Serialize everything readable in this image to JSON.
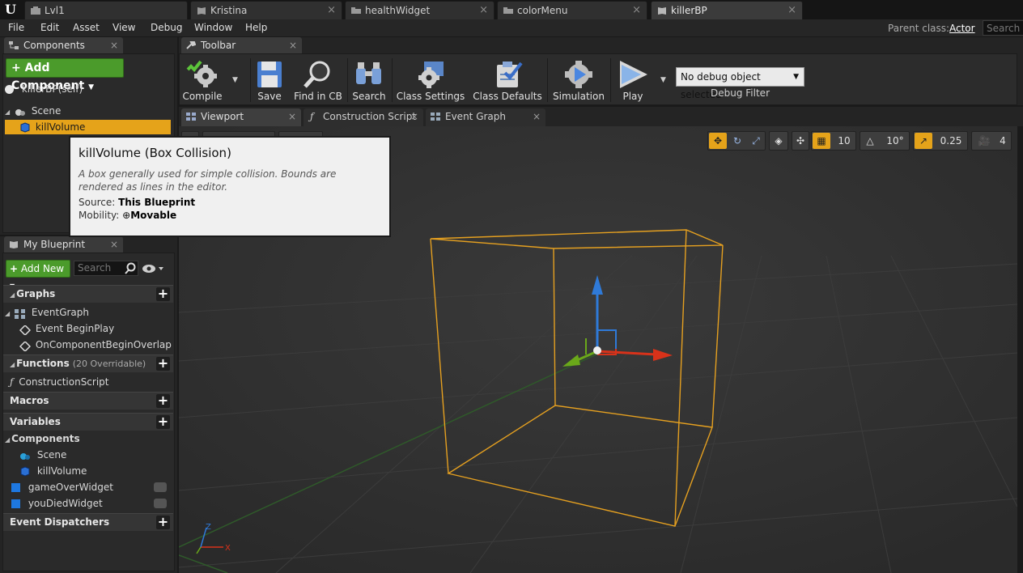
{
  "document_tabs": [
    {
      "label": "Lvl1",
      "active": false
    },
    {
      "label": "Kristina",
      "active": false
    },
    {
      "label": "healthWidget",
      "active": false
    },
    {
      "label": "colorMenu",
      "active": false
    },
    {
      "label": "killerBP",
      "active": true
    }
  ],
  "menu": [
    "File",
    "Edit",
    "Asset",
    "View",
    "Debug",
    "Window",
    "Help"
  ],
  "parent_class": {
    "label": "Parent class:",
    "value": "Actor"
  },
  "top_search_placeholder": "Search",
  "components_panel": {
    "tab_label": "Components",
    "add_button": "Add Component",
    "items": [
      {
        "label": "killerBP(self)",
        "icon": "white-circle-icon"
      },
      {
        "label": "Scene",
        "icon": "scene-icon"
      },
      {
        "label": "killVolume",
        "icon": "cube-icon",
        "selected": true
      }
    ]
  },
  "tooltip": {
    "title": "killVolume (Box Collision)",
    "description": "A box generally used for simple collision. Bounds are rendered as lines in the editor.",
    "source_label": "Source:",
    "source_value": "This Blueprint",
    "mobility_label": "Mobility:",
    "mobility_value": "Movable"
  },
  "my_blueprint": {
    "tab_label": "My Blueprint",
    "add_new": "Add New",
    "search_placeholder": "Search",
    "graphs_label": "Graphs",
    "event_graph": "EventGraph",
    "events": [
      "Event BeginPlay",
      "OnComponentBeginOverlap"
    ],
    "functions_label": "Functions",
    "functions_sub": "(20 Overridable)",
    "construction_script": "ConstructionScript",
    "macros_label": "Macros",
    "variables_label": "Variables",
    "components_label": "Components",
    "component_vars": [
      "Scene",
      "killVolume"
    ],
    "variables": [
      "gameOverWidget",
      "youDiedWidget"
    ],
    "dispatchers_label": "Event Dispatchers"
  },
  "toolbar": {
    "tab_label": "Toolbar",
    "buttons": [
      "Compile",
      "Save",
      "Find in CB",
      "Search",
      "Class Settings",
      "Class Defaults",
      "Simulation",
      "Play"
    ],
    "debug_select": "No debug object selected",
    "debug_label": "Debug Filter"
  },
  "editor_tabs": [
    "Viewport",
    "Construction Script",
    "Event Graph"
  ],
  "viewport_controls": {
    "grid_snap": "10",
    "rotation_snap": "10°",
    "scale_snap": "0.25",
    "camera_speed": "4"
  },
  "axis_labels": {
    "x": "X",
    "z": "Z"
  },
  "colors": {
    "accent_green": "#4b9b2b",
    "selection_orange": "#e5a31a",
    "box_wire": "#e5a020",
    "axis_red": "#d8321a",
    "axis_green": "#6aa81a",
    "axis_blue": "#2f7ad8"
  }
}
